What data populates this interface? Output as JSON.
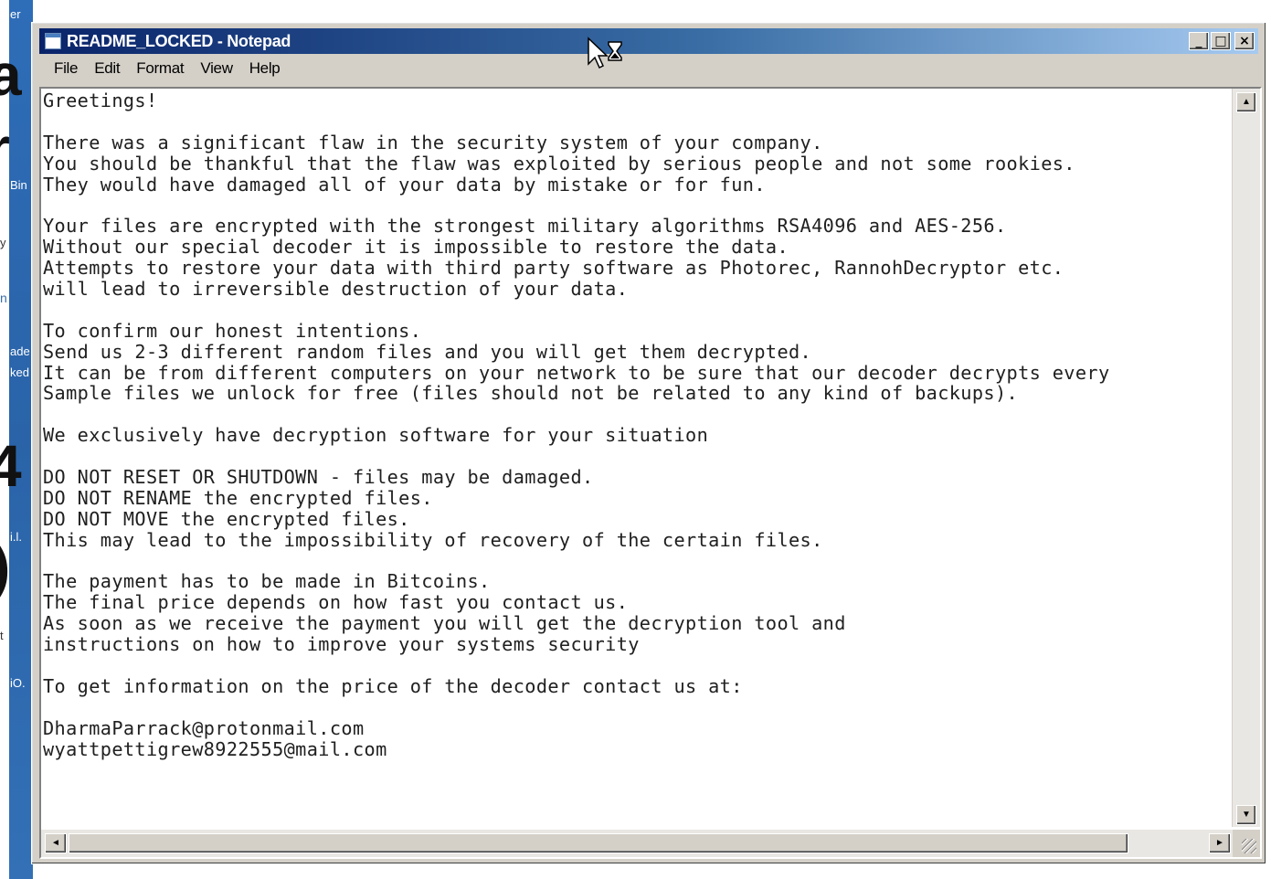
{
  "desktop": {
    "labels": [
      "er",
      "Bin",
      "y",
      "n",
      "ade",
      "ked",
      "i.l.",
      "t",
      "iO."
    ],
    "big_chars": [
      "a",
      "r",
      "4",
      ")"
    ]
  },
  "window": {
    "title": "README_LOCKED - Notepad",
    "controls": {
      "minimize": "_",
      "maximize": "□",
      "close": "×"
    }
  },
  "menu": [
    "File",
    "Edit",
    "Format",
    "View",
    "Help"
  ],
  "document": {
    "lines": [
      "Greetings!",
      "",
      "There was a significant flaw in the security system of your company.",
      "You should be thankful that the flaw was exploited by serious people and not some rookies.",
      "They would have damaged all of your data by mistake or for fun.",
      "",
      "Your files are encrypted with the strongest military algorithms RSA4096 and AES-256.",
      "Without our special decoder it is impossible to restore the data.",
      "Attempts to restore your data with third party software as Photorec, RannohDecryptor etc.",
      "will lead to irreversible destruction of your data.",
      "",
      "To confirm our honest intentions.",
      "Send us 2-3 different random files and you will get them decrypted.",
      "It can be from different computers on your network to be sure that our decoder decrypts every",
      "Sample files we unlock for free (files should not be related to any kind of backups).",
      "",
      "We exclusively have decryption software for your situation",
      "",
      "DO NOT RESET OR SHUTDOWN - files may be damaged.",
      "DO NOT RENAME the encrypted files.",
      "DO NOT MOVE the encrypted files.",
      "This may lead to the impossibility of recovery of the certain files.",
      "",
      "The payment has to be made in Bitcoins.",
      "The final price depends on how fast you contact us.",
      "As soon as we receive the payment you will get the decryption tool and",
      "instructions on how to improve your systems security",
      "",
      "To get information on the price of the decoder contact us at:",
      "",
      "DharmaParrack@protonmail.com",
      "wyattpettigrew8922555@mail.com"
    ]
  },
  "scrollbars": {
    "up": "▲",
    "down": "▼",
    "left": "◄",
    "right": "►"
  },
  "colors": {
    "titlebar_start": "#0a246a",
    "titlebar_end": "#a6caf0",
    "chrome": "#d4d0c8",
    "desktop": "#2e6db8"
  }
}
